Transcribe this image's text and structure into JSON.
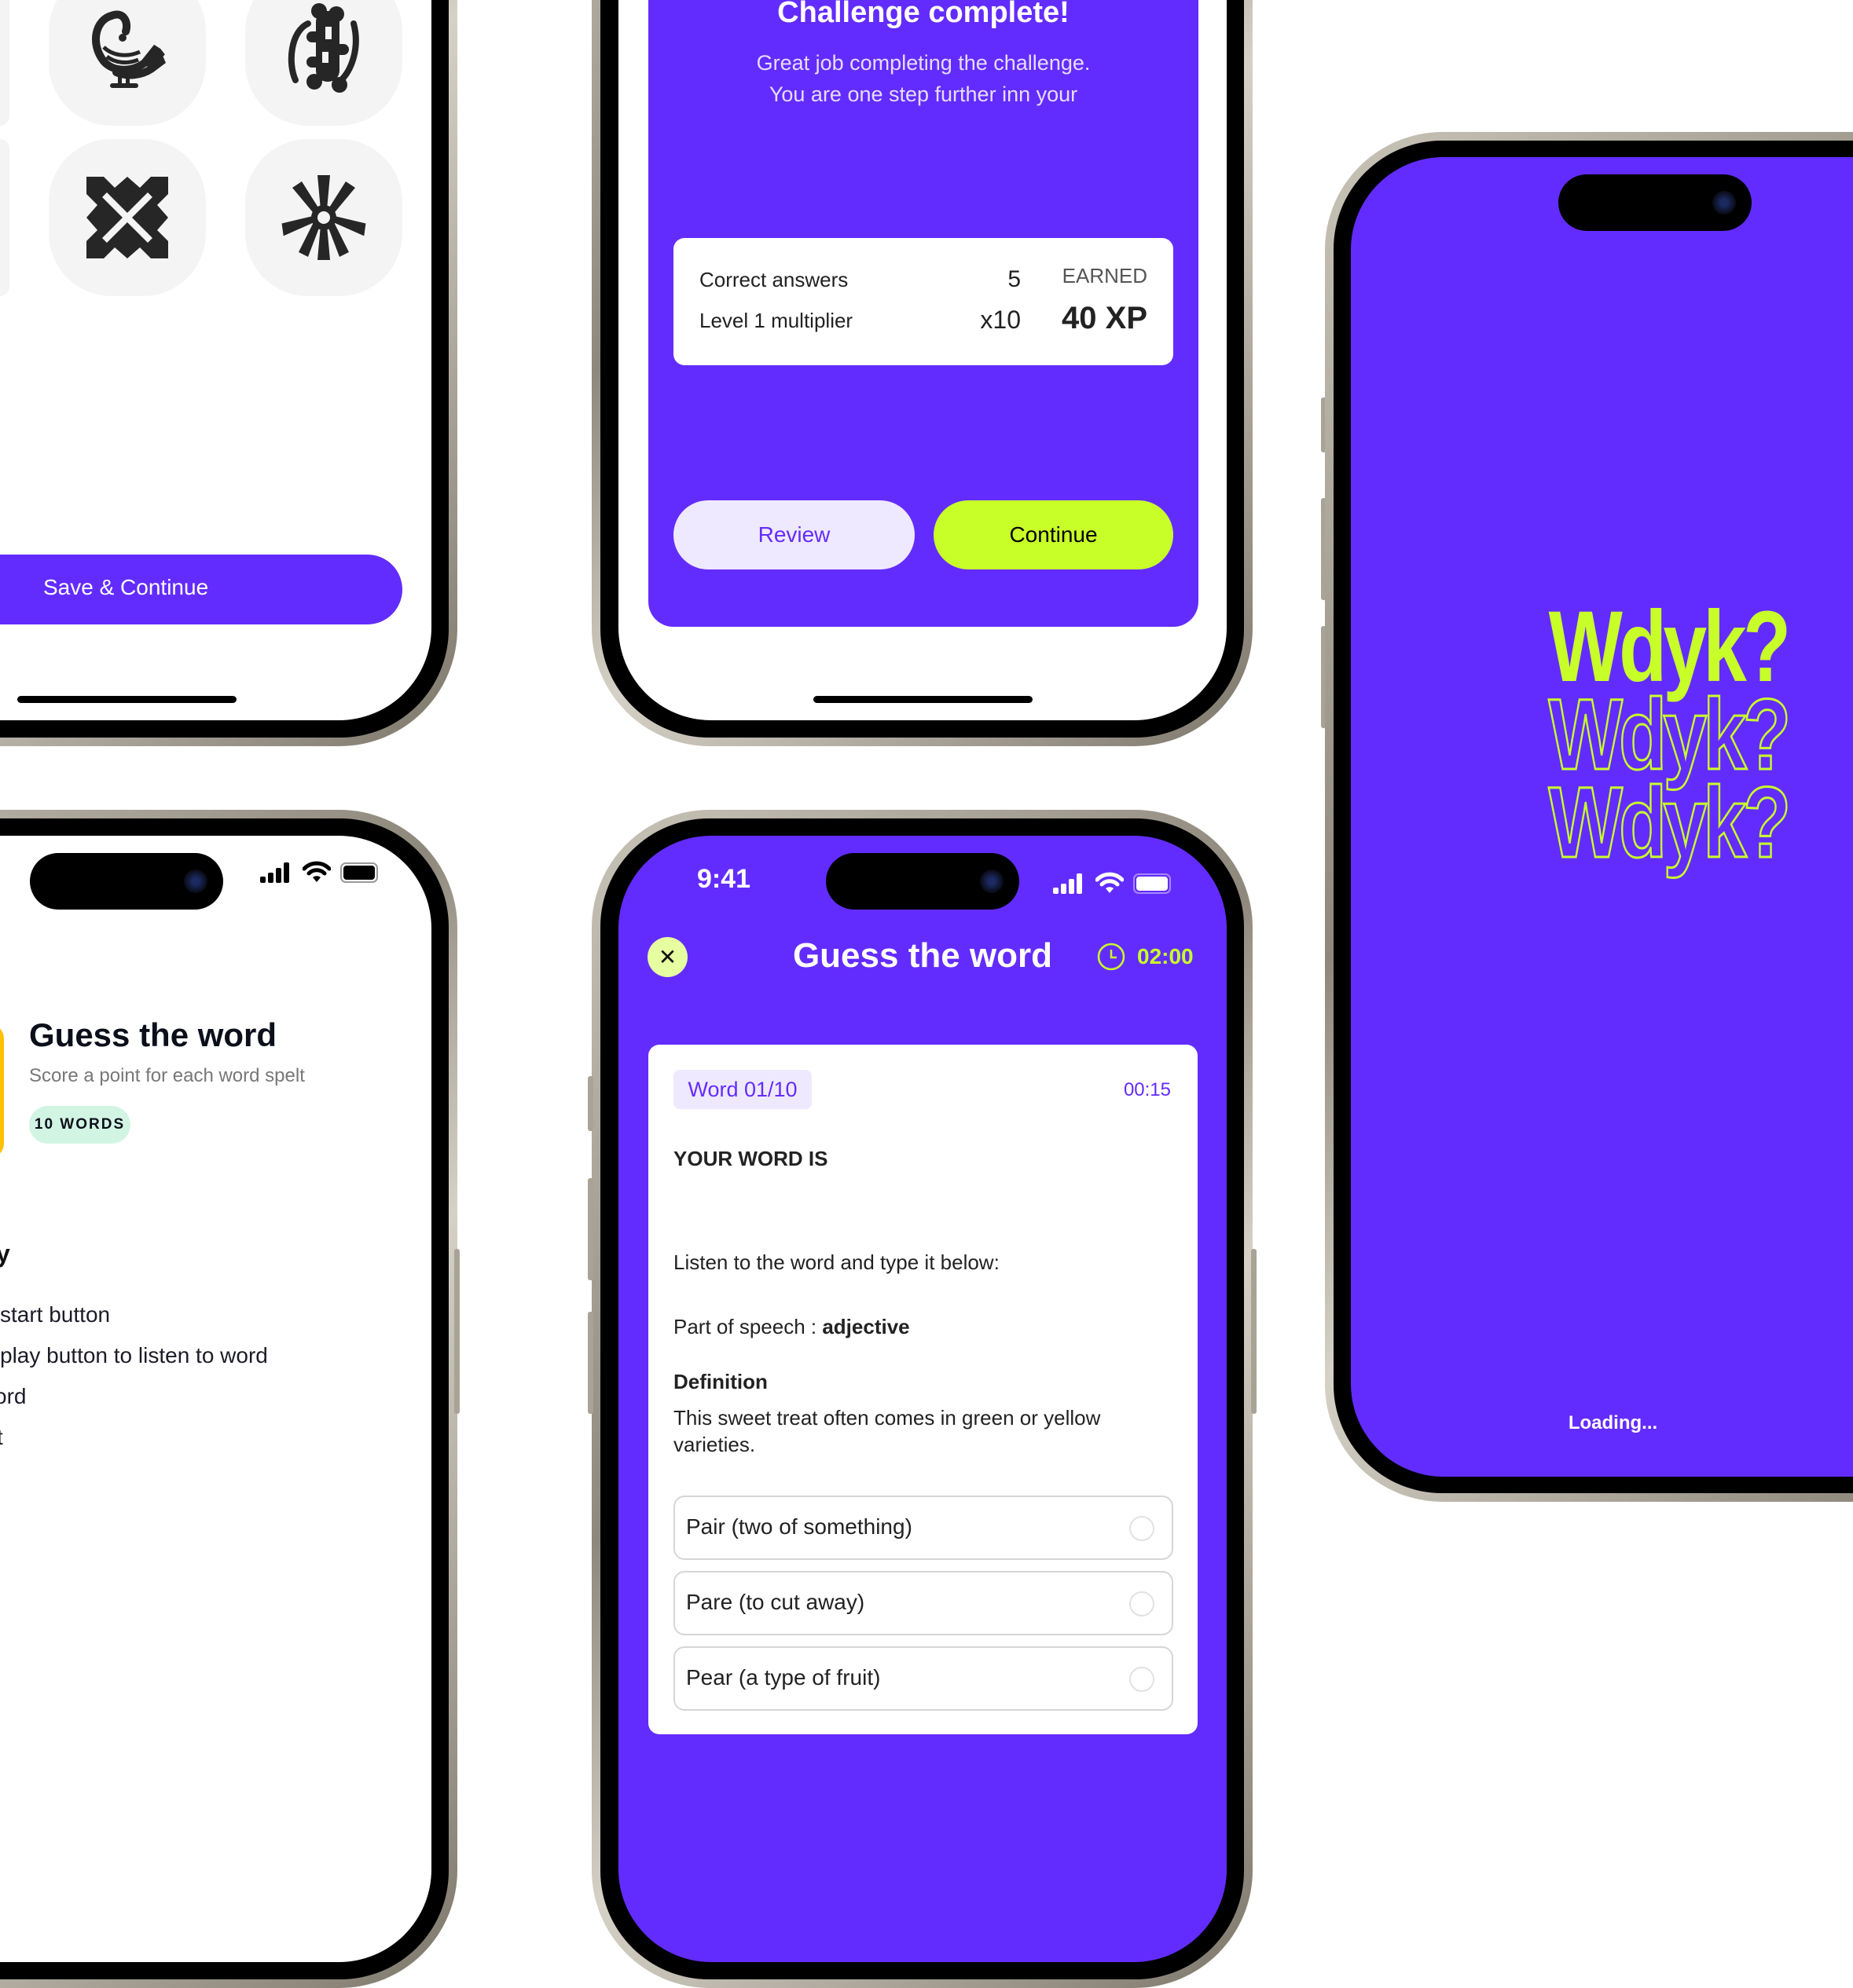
{
  "colors": {
    "brand_purple": "#632cff",
    "accent_lime": "#c8ff29",
    "review_bg": "#efe9ff",
    "badge_green": "#d2f5e3",
    "game_tile_yellow": "#ffc107",
    "text_dark": "#1c1c1e"
  },
  "symbols_screen": {
    "symbols": [
      {
        "name": "sankofa-bird-icon"
      },
      {
        "name": "gye-nyame-icon"
      },
      {
        "name": "dame-dame-cross-icon"
      },
      {
        "name": "asterisk-flower-icon"
      }
    ],
    "save_button": "Save & Continue"
  },
  "challenge_screen": {
    "title": "Challenge complete!",
    "subtitle_line1": "Great job completing the challenge.",
    "subtitle_line2": "You are one step further inn your",
    "results": {
      "rows": [
        {
          "label": "Correct answers",
          "value": "5"
        },
        {
          "label": "Level 1 multiplier",
          "value": "x10"
        }
      ],
      "earned_label": "EARNED",
      "earned_value": "40 XP"
    },
    "review_button": "Review",
    "continue_button": "Continue"
  },
  "game_intro_screen": {
    "status_bar": {
      "signal": "signal-icon",
      "wifi": "wifi-icon",
      "battery": "battery-icon"
    },
    "game_title": "Guess the word",
    "game_subtitle": "Score a point for each word spelt",
    "badge": "10 WORDS",
    "how_to_heading_partial": "y",
    "steps_partial": [
      "start button",
      "play button to listen to word",
      "ord",
      "t"
    ]
  },
  "quiz_screen": {
    "status_bar": {
      "time": "9:41"
    },
    "header": {
      "close_icon": "close-icon",
      "title": "Guess the word",
      "timer": "02:00"
    },
    "card": {
      "word_counter": "Word 01/10",
      "word_timer": "00:15",
      "your_word_label": "YOUR WORD IS",
      "instruction": "Listen to the word and type it below:",
      "pos_label": "Part of speech : ",
      "pos_value": "adjective",
      "definition_label": "Definition",
      "definition_text": "This sweet treat often comes in green or yellow varieties.",
      "options": [
        {
          "label": "Pair (two of something)",
          "selected": false
        },
        {
          "label": "Pare (to cut away)",
          "selected": false
        },
        {
          "label": "Pear (a type of fruit)",
          "selected": false
        }
      ]
    }
  },
  "splash_screen": {
    "logo_lines": [
      "Wdyk?",
      "Wdyk?",
      "Wdyk?"
    ],
    "loading_text": "Loading..."
  }
}
